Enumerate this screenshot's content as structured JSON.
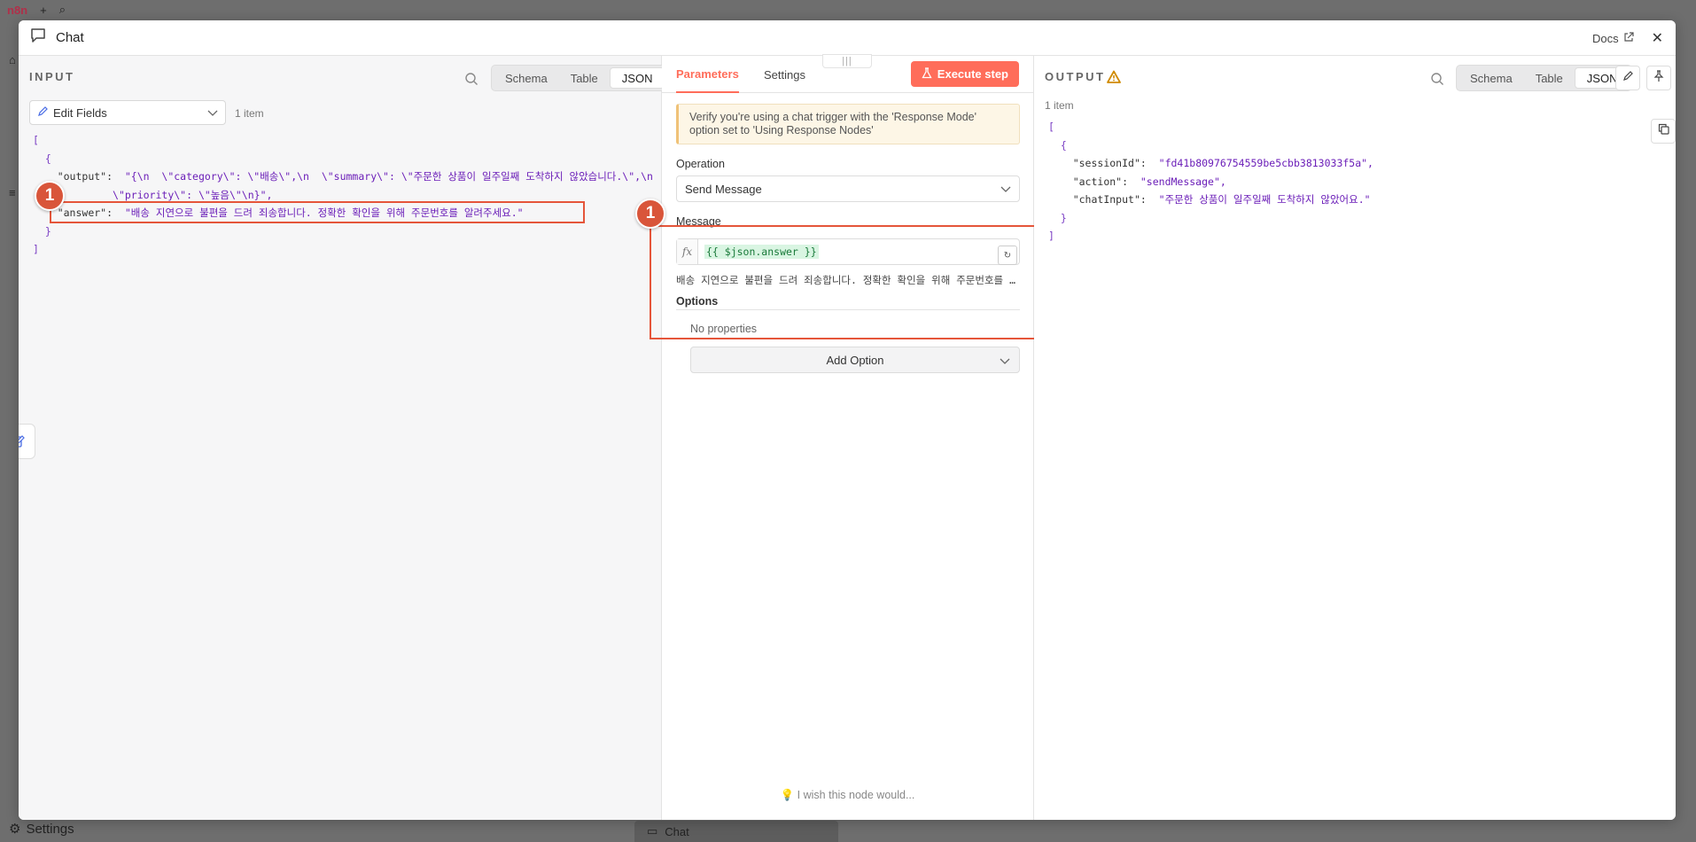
{
  "background": {
    "app_name": "n8n",
    "settings_label": "Settings",
    "chat_tab_label": "Chat"
  },
  "modal": {
    "title": "Chat",
    "docs_label": "Docs"
  },
  "input_panel": {
    "label": "INPUT",
    "tabs": [
      "Schema",
      "Table",
      "JSON"
    ],
    "active_tab": "JSON",
    "source_select": "Edit Fields",
    "item_count": "1 item",
    "json": {
      "open_bracket": "[",
      "open_brace": "{",
      "output_key": "\"output\":",
      "output_value_1": "\"{\\n  \\\"category\\\": \\\"배송\\\",\\n  \\\"summary\\\": \\\"주문한 상품이 일주일째 도착하지 않았습니다.\\\",\\n",
      "output_value_2": "\\\"priority\\\": \\\"높음\\\"\\n}\",",
      "answer_key": "\"answer\":",
      "answer_value": "\"배송 지연으로 불편을 드려 죄송합니다. 정확한 확인을 위해 주문번호를 알려주세요.\"",
      "close_brace": "}",
      "close_bracket": "]"
    },
    "badge": "1"
  },
  "params_panel": {
    "drag_handle": "|||",
    "tab_parameters": "Parameters",
    "tab_settings": "Settings",
    "execute_label": "Execute step",
    "notice_text": "Verify you're using a chat trigger with the 'Response Mode' option set to 'Using Response Nodes'",
    "operation_label": "Operation",
    "operation_value": "Send Message",
    "message_label": "Message",
    "fx_label": "fx",
    "expression": "{{ $json.answer }}",
    "expression_result": "배송 지연으로 불편을 드려 죄송합니다. 정확한 확인을 위해 주문번호를 알려주세요.",
    "options_label": "Options",
    "no_properties": "No properties",
    "add_option_label": "Add Option",
    "wish_text": "I wish this node would...",
    "badge": "1"
  },
  "output_panel": {
    "label": "OUTPUT",
    "item_count": "1 item",
    "tabs": [
      "Schema",
      "Table",
      "JSON"
    ],
    "active_tab": "JSON",
    "json": {
      "open_bracket": "[",
      "open_brace": "{",
      "session_key": "\"sessionId\":",
      "session_value": "\"fd41b80976754559be5cbb3813033f5a\",",
      "action_key": "\"action\":",
      "action_value": "\"sendMessage\",",
      "chat_key": "\"chatInput\":",
      "chat_value": "\"주문한 상품이 일주일째 도착하지 않았어요.\"",
      "close_brace": "}",
      "close_bracket": "]"
    }
  },
  "colors": {
    "accent": "#ff6d5a",
    "highlight": "#e5553a",
    "string": "#6b1eb8",
    "warning": "#e0a000"
  }
}
